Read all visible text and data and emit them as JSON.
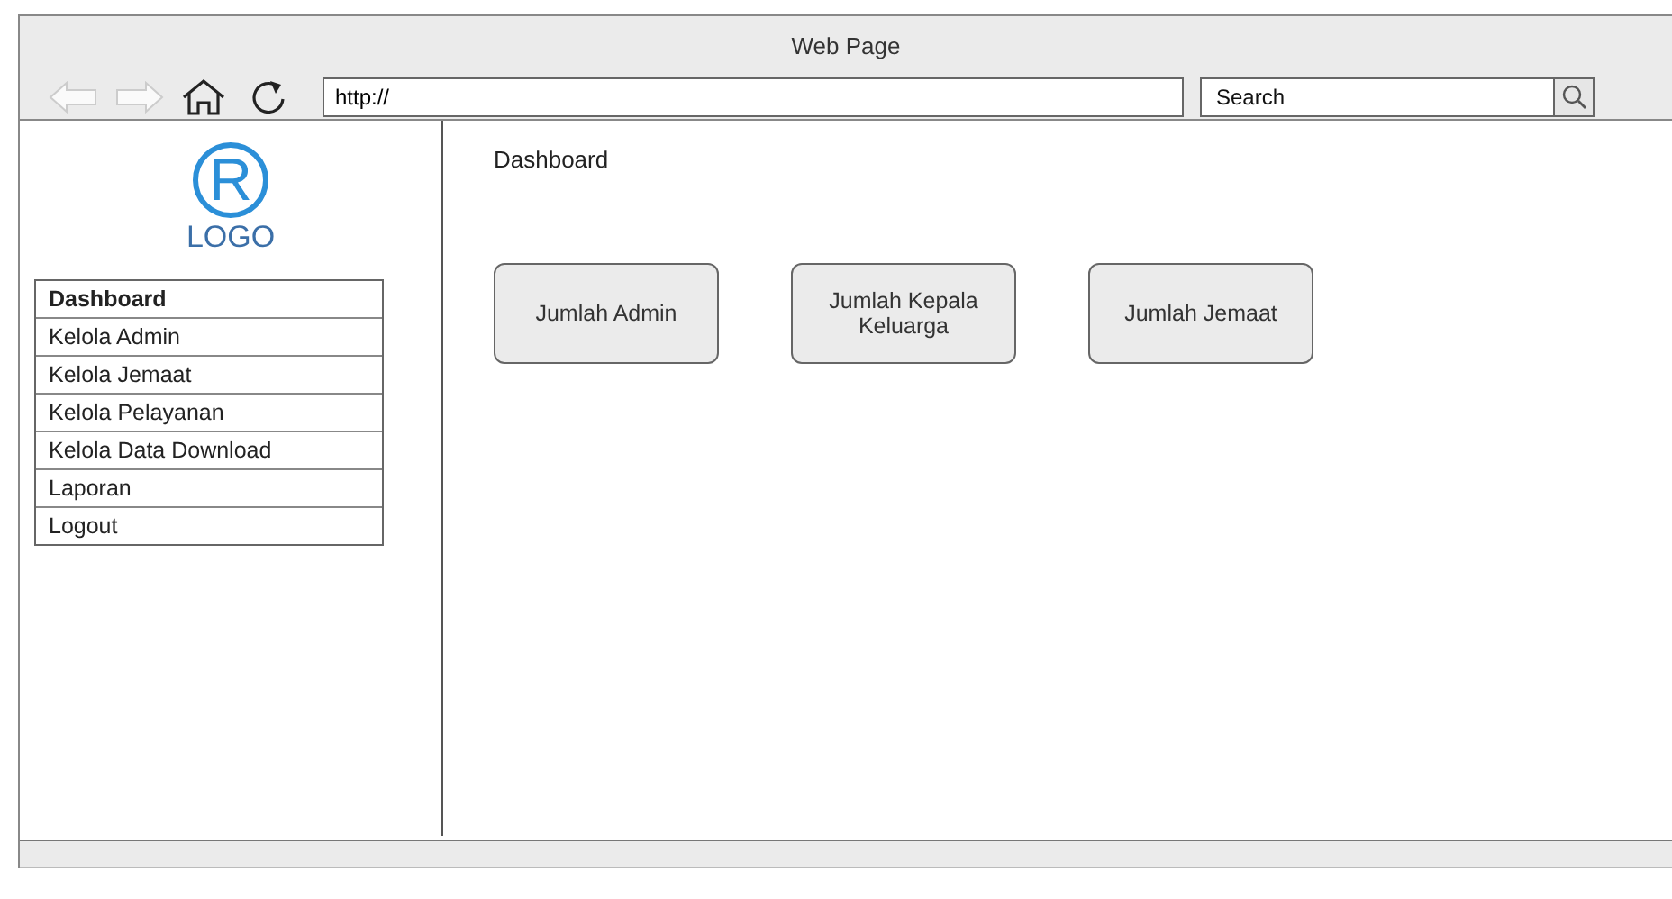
{
  "window": {
    "title": "Web Page"
  },
  "toolbar": {
    "back_disabled": true,
    "forward_disabled": true,
    "address": "http://",
    "search": {
      "placeholder": "Search"
    }
  },
  "logo": {
    "mark": "R",
    "text": "LOGO"
  },
  "menu": [
    {
      "label": "Dashboard",
      "selected": true
    },
    {
      "label": "Kelola Admin",
      "selected": false
    },
    {
      "label": "Kelola Jemaat",
      "selected": false
    },
    {
      "label": "Kelola Pelayanan",
      "selected": false
    },
    {
      "label": "Kelola Data Download",
      "selected": false
    },
    {
      "label": "Laporan",
      "selected": false
    },
    {
      "label": "Logout",
      "selected": false
    }
  ],
  "content": {
    "heading": "Dashboard",
    "cards": [
      "Jumlah Admin",
      "Jumlah Kepala Keluarga",
      "Jumlah Jemaat"
    ]
  }
}
